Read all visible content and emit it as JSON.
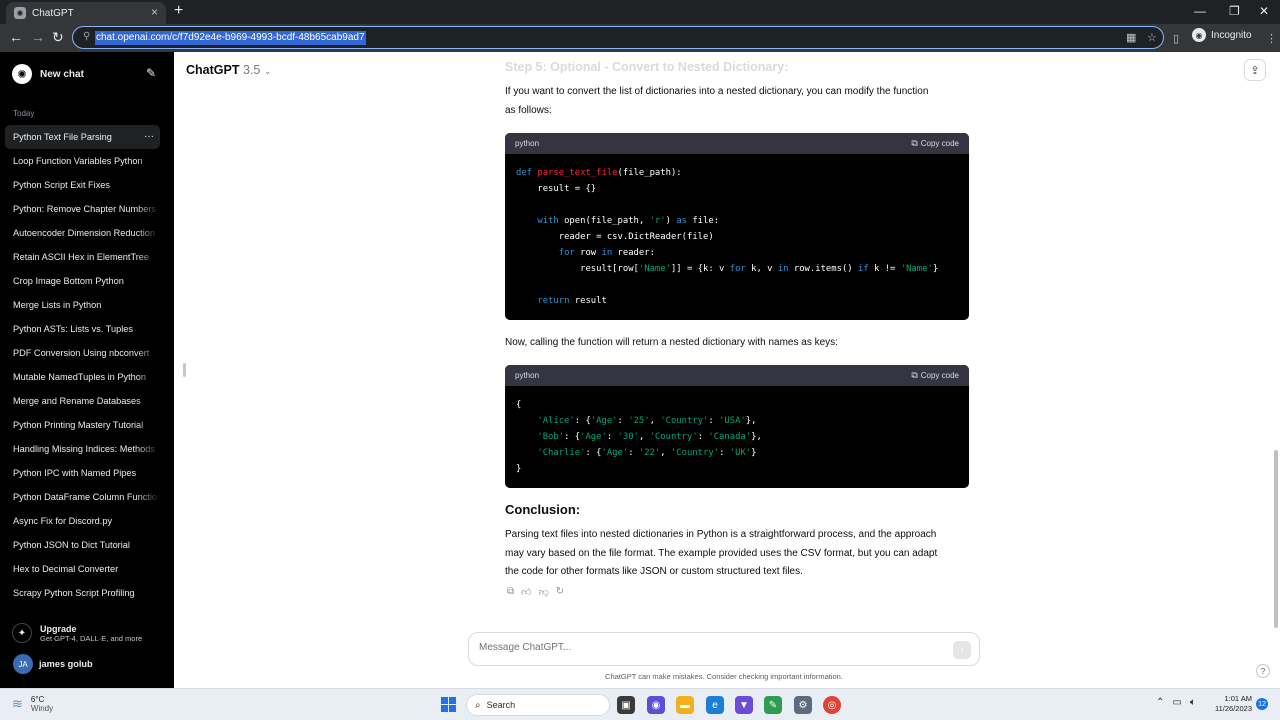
{
  "browser": {
    "tab_title": "ChatGPT",
    "url": "chat.openai.com/c/f7d92e4e-b969-4993-bcdf-48b65cab9ad7",
    "incognito_label": "Incognito"
  },
  "sidebar": {
    "new_chat": "New chat",
    "section_today": "Today",
    "items": [
      "Python Text File Parsing",
      "Loop Function Variables Python",
      "Python Script Exit Fixes",
      "Python: Remove Chapter Numbers",
      "Autoencoder Dimension Reduction",
      "Retain ASCII Hex in ElementTree",
      "Crop Image Bottom Python",
      "Merge Lists in Python",
      "Python ASTs: Lists vs. Tuples",
      "PDF Conversion Using nbconvert",
      "Mutable NamedTuples in Python",
      "Merge and Rename Databases",
      "Python Printing Mastery Tutorial",
      "Handling Missing Indices: Methods",
      "Python IPC with Named Pipes",
      "Python DataFrame Column Functions",
      "Async Fix for Discord.py",
      "Python JSON to Dict Tutorial",
      "Hex to Decimal Converter",
      "Scrapy Python Script Profiling"
    ],
    "upgrade_title": "Upgrade",
    "upgrade_sub": "Get GPT-4, DALL·E, and more",
    "user_initials": "JA",
    "user_name": "james golub"
  },
  "header": {
    "model_name": "ChatGPT",
    "model_version": "3.5"
  },
  "message": {
    "step_heading": "Step 5: Optional - Convert to Nested Dictionary:",
    "para1_line1": "If you want to convert the list of dictionaries into a nested dictionary, you can modify the function",
    "para1_line2": "as follows:",
    "code1_lang": "python",
    "copy_label": "Copy code",
    "para2": "Now, calling the function will return a nested dictionary with names as keys:",
    "code2_lang": "python",
    "conclusion_heading": "Conclusion:",
    "conclusion_line1": "Parsing text files into nested dictionaries in Python is a straightforward process, and the approach",
    "conclusion_line2": "may vary based on the file format. The example provided uses the CSV format, but you can adapt",
    "conclusion_line3": "the code for other formats like JSON or custom structured text files."
  },
  "code1": {
    "l1_def": "def ",
    "l1_fn": "parse_text_file",
    "l1_rest": "(file_path):",
    "l2": "    result = {}",
    "l4_with": "    with ",
    "l4_open": "open(file_path, ",
    "l4_str": "'r'",
    "l4_close": ") ",
    "l4_as": "as",
    "l4_file": " file:",
    "l5": "        reader = csv.DictReader(file)",
    "l6_for": "        for ",
    "l6_row": "row ",
    "l6_in": "in",
    "l6_reader": " reader:",
    "l7_a": "            result[row[",
    "l7_name": "'Name'",
    "l7_b": "]] = {k: v ",
    "l7_for": "for",
    "l7_c": " k, v ",
    "l7_in": "in",
    "l7_d": " row.items() ",
    "l7_if": "if",
    "l7_e": " k != ",
    "l7_name2": "'Name'",
    "l7_f": "}",
    "l9_return": "    return",
    "l9_rest": " result"
  },
  "code2": {
    "l1": "{",
    "l2_k": "'Alice'",
    "l2_a": ": {",
    "l2_age": "'Age'",
    "l2_b": ": ",
    "l2_v1": "'25'",
    "l2_c": ", ",
    "l2_country": "'Country'",
    "l2_d": ": ",
    "l2_v2": "'USA'",
    "l2_e": "},",
    "l3_k": "'Bob'",
    "l3_a": ": {",
    "l3_age": "'Age'",
    "l3_b": ": ",
    "l3_v1": "'30'",
    "l3_c": ", ",
    "l3_country": "'Country'",
    "l3_d": ": ",
    "l3_v2": "'Canada'",
    "l3_e": "},",
    "l4_k": "'Charlie'",
    "l4_a": ": {",
    "l4_age": "'Age'",
    "l4_b": ": ",
    "l4_v1": "'22'",
    "l4_c": ", ",
    "l4_country": "'Country'",
    "l4_d": ": ",
    "l4_v2": "'UK'",
    "l4_e": "}",
    "l5": "}"
  },
  "composer": {
    "placeholder": "Message ChatGPT...",
    "disclaimer": "ChatGPT can make mistakes. Consider checking important information."
  },
  "taskbar": {
    "temperature": "6°C",
    "weather": "Windy",
    "search_label": "Search",
    "time": "1:01 AM",
    "date": "11/26/2023",
    "notifications": "12"
  },
  "colors": {
    "accent": "#1a73e8",
    "code_keyword": "#2e95d3",
    "code_function": "#f22c3d",
    "code_string": "#00a67d"
  }
}
